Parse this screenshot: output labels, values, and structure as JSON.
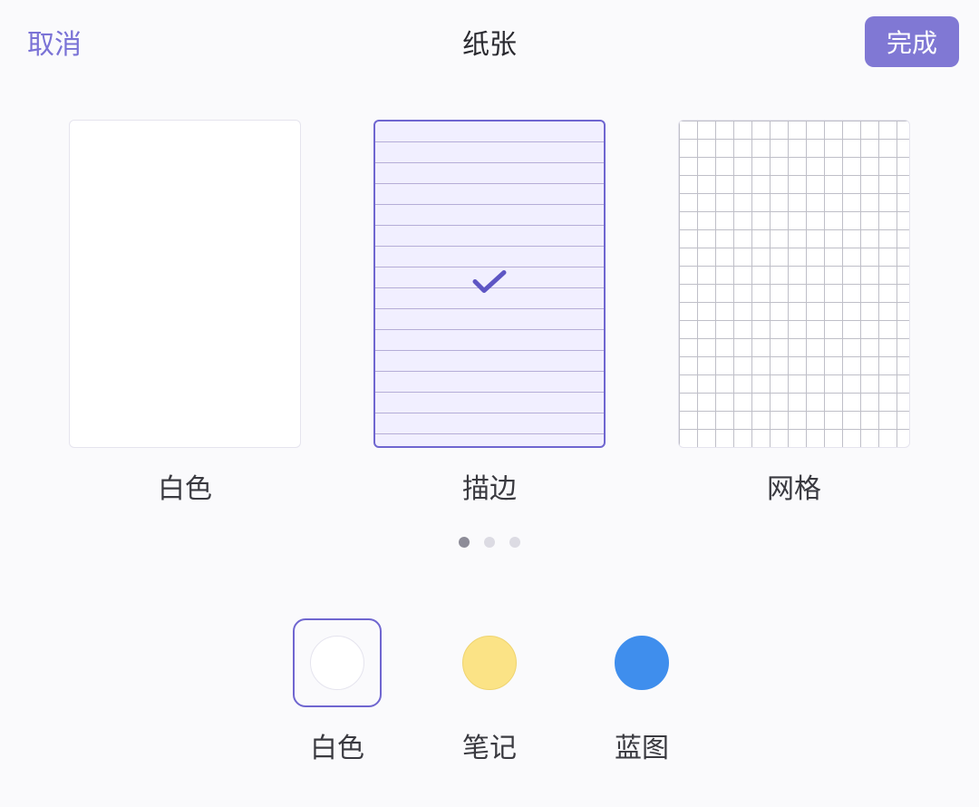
{
  "header": {
    "cancel_label": "取消",
    "title": "纸张",
    "done_label": "完成"
  },
  "papers": [
    {
      "label": "白色",
      "selected": false,
      "type": "blank"
    },
    {
      "label": "描边",
      "selected": true,
      "type": "lined"
    },
    {
      "label": "网格",
      "selected": false,
      "type": "grid"
    }
  ],
  "page_indicator": {
    "count": 3,
    "active_index": 0
  },
  "colors": [
    {
      "label": "白色",
      "selected": true,
      "swatch": "white"
    },
    {
      "label": "笔记",
      "selected": false,
      "swatch": "note"
    },
    {
      "label": "蓝图",
      "selected": false,
      "swatch": "blue"
    }
  ],
  "theme": {
    "accent": "#6f66d0",
    "done_button_bg": "#8078d4"
  }
}
